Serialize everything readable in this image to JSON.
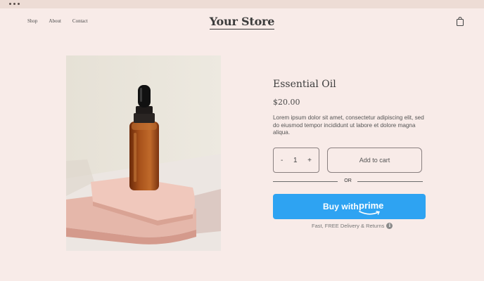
{
  "nav": {
    "links": [
      "Shop",
      "About",
      "Contact"
    ]
  },
  "header": {
    "store_title": "Your Store",
    "cart_icon": "shopping-bag-icon"
  },
  "product": {
    "title": "Essential Oil",
    "price": "$20.00",
    "description": "Lorem ipsum dolor sit amet, consectetur adipiscing elit, sed do eiusmod tempor incididunt ut labore et dolore magna aliqua.",
    "image": "amber-dropper-bottle-photo"
  },
  "purchase": {
    "qty_minus": "-",
    "qty_value": "1",
    "qty_plus": "+",
    "add_to_cart": "Add to cart",
    "or_label": "OR",
    "prime_buy_text": "Buy with",
    "prime_word": "prime",
    "delivery_text": "Fast, FREE Delivery & Returns",
    "info_icon": "i"
  },
  "colors": {
    "background": "#f8ebe8",
    "prime_blue": "#2ea3f2"
  }
}
